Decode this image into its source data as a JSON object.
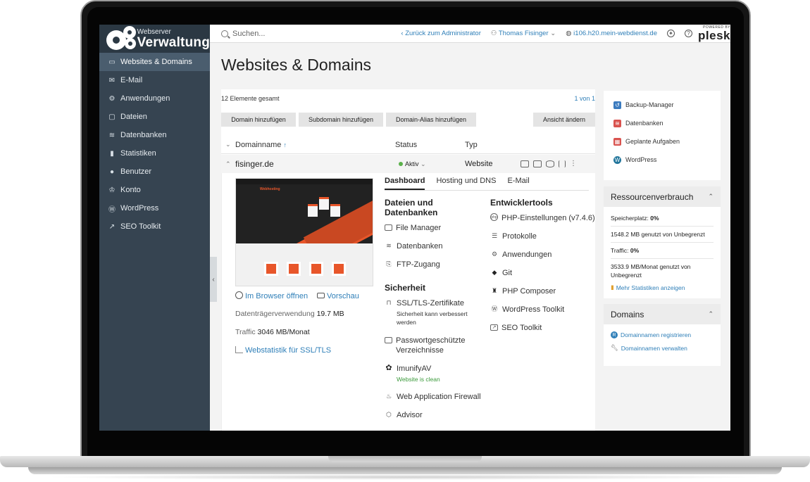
{
  "sidebar": {
    "brand_small": "Webserver",
    "brand_big": "Verwaltung",
    "items": [
      {
        "label": "Websites & Domains",
        "icon": "monitor-icon"
      },
      {
        "label": "E-Mail",
        "icon": "envelope-icon"
      },
      {
        "label": "Anwendungen",
        "icon": "gear-icon"
      },
      {
        "label": "Dateien",
        "icon": "folder-icon"
      },
      {
        "label": "Datenbanken",
        "icon": "layers-icon"
      },
      {
        "label": "Statistiken",
        "icon": "bar-chart-icon"
      },
      {
        "label": "Benutzer",
        "icon": "user-icon"
      },
      {
        "label": "Konto",
        "icon": "crown-icon"
      },
      {
        "label": "WordPress",
        "icon": "wordpress-icon"
      },
      {
        "label": "SEO Toolkit",
        "icon": "chart-line-icon"
      }
    ]
  },
  "topbar": {
    "search_placeholder": "Suchen...",
    "back_link": "Zurück zum Administrator",
    "user": "Thomas Fisinger",
    "server": "i106.h20.mein-webdienst.de",
    "plesk_small": "POWERED BY",
    "plesk_big": "plesk"
  },
  "page": {
    "title": "Websites & Domains",
    "count": "12 Elemente gesamt",
    "paging": "1 von 1",
    "buttons": {
      "add_domain": "Domain hinzufügen",
      "add_subdomain": "Subdomain hinzufügen",
      "add_alias": "Domain-Alias hinzufügen",
      "change_view": "Ansicht ändern"
    },
    "columns": {
      "name": "Domainname",
      "sort": "↑",
      "status": "Status",
      "type": "Typ"
    },
    "row": {
      "domain": "fisinger.de",
      "status": "Aktiv",
      "type": "Website"
    }
  },
  "detail": {
    "thumb_text": "Webhosting",
    "open_browser": "Im Browser öffnen",
    "preview": "Vorschau",
    "disk_label": "Datenträgerverwendung",
    "disk_value": "19.7 MB",
    "traffic_label": "Traffic",
    "traffic_value": "3046 MB/Monat",
    "webstats": "Webstatistik für SSL/TLS",
    "tabs": [
      "Dashboard",
      "Hosting und DNS",
      "E-Mail"
    ],
    "files_head": "Dateien und Datenbanken",
    "file_manager": "File Manager",
    "databases": "Datenbanken",
    "ftp": "FTP-Zugang",
    "security_head": "Sicherheit",
    "ssl": "SSL/TLS-Zertifikate",
    "ssl_note": "Sicherheit kann verbessert werden",
    "protected_dirs": "Passwortgeschützte Verzeichnisse",
    "imunify": "ImunifyAV",
    "imunify_note": "Website is clean",
    "waf": "Web Application Firewall",
    "advisor": "Advisor",
    "dev_head": "Entwicklertools",
    "php_settings": "PHP-Einstellungen (v7.4.6)",
    "logs": "Protokolle",
    "apps": "Anwendungen",
    "git": "Git",
    "composer": "PHP Composer",
    "wp_toolkit": "WordPress Toolkit",
    "seo_toolkit": "SEO Toolkit"
  },
  "panels": {
    "quick": [
      {
        "label": "Backup-Manager",
        "color": "#3b7bbf"
      },
      {
        "label": "Datenbanken",
        "color": "#d9534f"
      },
      {
        "label": "Geplante Aufgaben",
        "color": "#d9534f"
      },
      {
        "label": "WordPress",
        "color": "#21759b"
      }
    ],
    "resources": {
      "title": "Ressourcenverbrauch",
      "disk_label": "Speicherplatz:",
      "disk_pct": "0%",
      "disk_usage": "1548.2 MB genutzt von Unbegrenzt",
      "traffic_label": "Traffic:",
      "traffic_pct": "0%",
      "traffic_usage": "3533.9 MB/Monat genutzt von Unbegrenzt",
      "more_stats": "Mehr Statistiken anzeigen"
    },
    "domains": {
      "title": "Domains",
      "register": "Domainnamen registrieren",
      "manage": "Domainnamen verwalten"
    }
  }
}
